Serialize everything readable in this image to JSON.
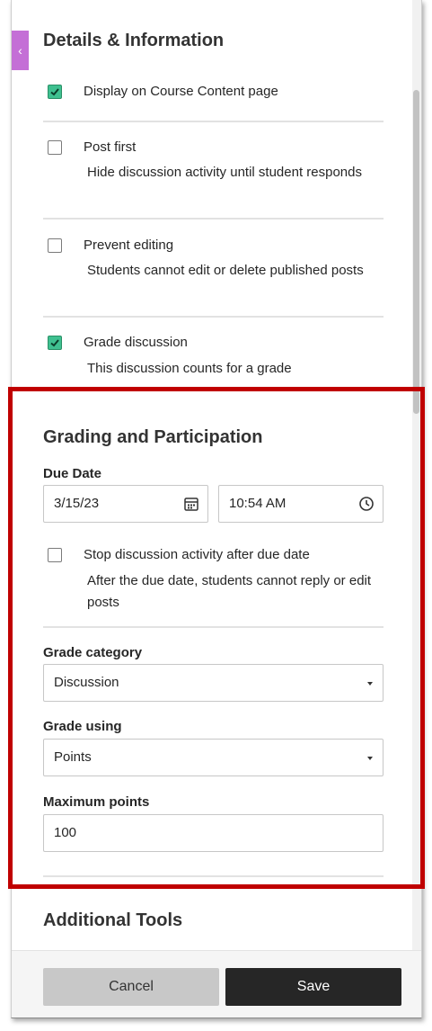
{
  "details": {
    "heading": "Details & Information",
    "display_label": "Display on Course Content page",
    "post_first_label": "Post first",
    "post_first_desc": "Hide discussion activity until student responds",
    "prevent_label": "Prevent editing",
    "prevent_desc": "Students cannot edit or delete published posts",
    "grade_label": "Grade discussion",
    "grade_desc": "This discussion counts for a grade",
    "display_checked": true,
    "post_first_checked": false,
    "prevent_checked": false,
    "grade_checked": true
  },
  "grading": {
    "heading": "Grading and Participation",
    "due_label": "Due Date",
    "due_date": "3/15/23",
    "due_time": "10:54 AM",
    "stop_label": "Stop discussion activity after due date",
    "stop_desc": "After the due date, students cannot reply or edit posts",
    "stop_checked": false,
    "category_label": "Grade category",
    "category_value": "Discussion",
    "using_label": "Grade using",
    "using_value": "Points",
    "max_label": "Maximum points",
    "max_value": "100"
  },
  "additional": {
    "heading": "Additional Tools"
  },
  "footer": {
    "cancel_label": "Cancel",
    "save_label": "Save"
  },
  "colors": {
    "accent_tab": "#c46fd6",
    "checkbox_on": "#3fc090",
    "highlight_border": "#c00000",
    "save_bg": "#262626"
  }
}
